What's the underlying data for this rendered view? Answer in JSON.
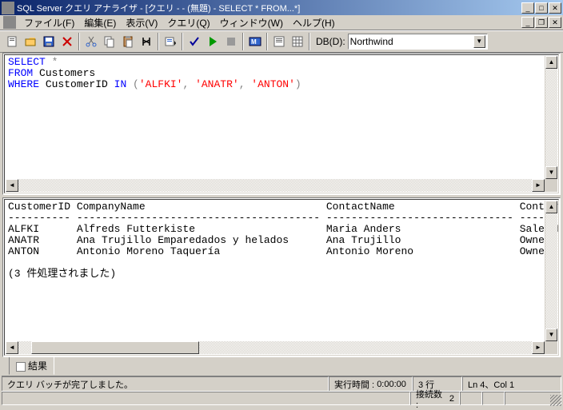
{
  "title": "SQL Server クエリ アナライザ - [クエリ -                                 - (無題) - SELECT *    FROM...*]",
  "menu": {
    "file": "ファイル(F)",
    "edit": "編集(E)",
    "view": "表示(V)",
    "query": "クエリ(Q)",
    "window": "ウィンドウ(W)",
    "help": "ヘルプ(H)"
  },
  "db": {
    "label": "DB(D):",
    "value": "Northwind"
  },
  "sql": {
    "line1_kw": "SELECT",
    "line1_rest": " *",
    "line2_kw": "FROM",
    "line2_rest": " Customers",
    "line3_kw": "WHERE",
    "line3_mid": " CustomerID ",
    "line3_in": "IN ",
    "line3_p1": "(",
    "line3_s1": "'ALFKI'",
    "line3_c1": ", ",
    "line3_s2": "'ANATR'",
    "line3_c2": ", ",
    "line3_s3": "'ANTON'",
    "line3_p2": ")"
  },
  "results_text": "CustomerID CompanyName                             ContactName                    ContactTitle\n---------- --------------------------------------- ------------------------------ -------------\nALFKI      Alfreds Futterkiste                     Maria Anders                   Sales Represe\nANATR      Ana Trujillo Emparedados y helados      Ana Trujillo                   Owner\nANTON      Antonio Moreno Taquería                 Antonio Moreno                 Owner\n\n(3 件処理されました)",
  "tab_results": "結果",
  "status": {
    "msg": "クエリ バッチが完了しました。",
    "time_label": "実行時間 :",
    "time": "0:00:00",
    "rows": "3 行",
    "pos": "Ln 4、Col 1",
    "conn_label": "接続数 :",
    "conn": "2"
  }
}
